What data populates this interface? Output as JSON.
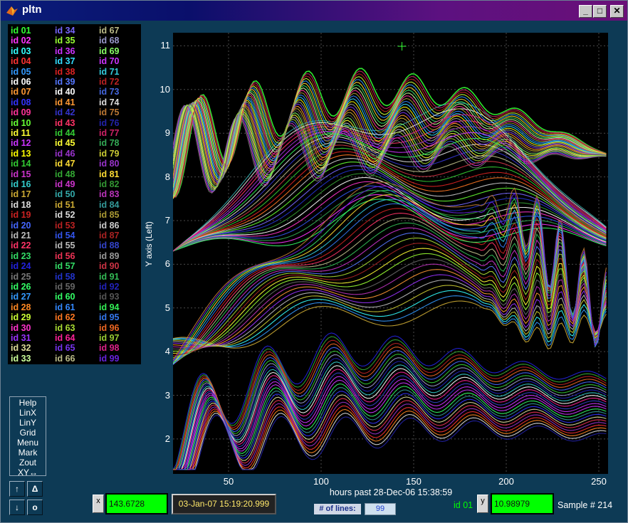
{
  "window": {
    "title": "pltn",
    "icon": "matlab-icon",
    "controls": [
      "_",
      "□",
      "✕"
    ]
  },
  "legend": {
    "items": [
      {
        "label": "id 01",
        "color": "#33ff33"
      },
      {
        "label": "id 02",
        "color": "#ff33ff"
      },
      {
        "label": "id 03",
        "color": "#33ffff"
      },
      {
        "label": "id 04",
        "color": "#ff3333"
      },
      {
        "label": "id 05",
        "color": "#3399ff"
      },
      {
        "label": "id 06",
        "color": "#ffffff"
      },
      {
        "label": "id 07",
        "color": "#ff9933"
      },
      {
        "label": "id 08",
        "color": "#3333ff"
      },
      {
        "label": "id 09",
        "color": "#ff3399"
      },
      {
        "label": "id 10",
        "color": "#66ff33"
      },
      {
        "label": "id 11",
        "color": "#ffff33"
      },
      {
        "label": "id 12",
        "color": "#cc33ff"
      },
      {
        "label": "id 13",
        "color": "#ffff00"
      },
      {
        "label": "id 14",
        "color": "#33cc33"
      },
      {
        "label": "id 15",
        "color": "#cc33cc"
      },
      {
        "label": "id 16",
        "color": "#33cccc"
      },
      {
        "label": "id 17",
        "color": "#ccaa33"
      },
      {
        "label": "id 18",
        "color": "#dddddd"
      },
      {
        "label": "id 19",
        "color": "#cc2222"
      },
      {
        "label": "id 20",
        "color": "#4466ff"
      },
      {
        "label": "id 21",
        "color": "#bbbbbb"
      },
      {
        "label": "id 22",
        "color": "#ff3366"
      },
      {
        "label": "id 23",
        "color": "#33dd66"
      },
      {
        "label": "id 24",
        "color": "#2222dd"
      },
      {
        "label": "id 25",
        "color": "#777777"
      },
      {
        "label": "id 26",
        "color": "#33ff66"
      },
      {
        "label": "id 27",
        "color": "#3399ff"
      },
      {
        "label": "id 28",
        "color": "#ff8822"
      },
      {
        "label": "id 29",
        "color": "#ccff33"
      },
      {
        "label": "id 30",
        "color": "#ff33cc"
      },
      {
        "label": "id 31",
        "color": "#9933ff"
      },
      {
        "label": "id 32",
        "color": "#dddd99"
      },
      {
        "label": "id 33",
        "color": "#ccff99"
      },
      {
        "label": "id 34",
        "color": "#7766ff"
      },
      {
        "label": "id 35",
        "color": "#99ff33"
      },
      {
        "label": "id 36",
        "color": "#cc33ff"
      },
      {
        "label": "id 37",
        "color": "#33ddff"
      },
      {
        "label": "id 38",
        "color": "#dd2222"
      },
      {
        "label": "id 39",
        "color": "#5577ff"
      },
      {
        "label": "id 40",
        "color": "#ffffff"
      },
      {
        "label": "id 41",
        "color": "#ff9933"
      },
      {
        "label": "id 42",
        "color": "#3333cc"
      },
      {
        "label": "id 43",
        "color": "#ff3366"
      },
      {
        "label": "id 44",
        "color": "#33cc33"
      },
      {
        "label": "id 45",
        "color": "#ffff33"
      },
      {
        "label": "id 46",
        "color": "#9933cc"
      },
      {
        "label": "id 47",
        "color": "#ffdd33"
      },
      {
        "label": "id 48",
        "color": "#33aa33"
      },
      {
        "label": "id 49",
        "color": "#cc33cc"
      },
      {
        "label": "id 50",
        "color": "#33aaaa"
      },
      {
        "label": "id 51",
        "color": "#ccaa33"
      },
      {
        "label": "id 52",
        "color": "#dddddd"
      },
      {
        "label": "id 53",
        "color": "#bb2222"
      },
      {
        "label": "id 54",
        "color": "#3355ee"
      },
      {
        "label": "id 55",
        "color": "#bbbbbb"
      },
      {
        "label": "id 56",
        "color": "#ee3355"
      },
      {
        "label": "id 57",
        "color": "#33dd66"
      },
      {
        "label": "id 58",
        "color": "#2233cc"
      },
      {
        "label": "id 59",
        "color": "#666666"
      },
      {
        "label": "id 60",
        "color": "#33ff66"
      },
      {
        "label": "id 61",
        "color": "#3388ff"
      },
      {
        "label": "id 62",
        "color": "#ff7722"
      },
      {
        "label": "id 63",
        "color": "#aadd33"
      },
      {
        "label": "id 64",
        "color": "#ff2299"
      },
      {
        "label": "id 65",
        "color": "#7733ee"
      },
      {
        "label": "id 66",
        "color": "#bbbb88"
      },
      {
        "label": "id 67",
        "color": "#bbbb88"
      },
      {
        "label": "id 68",
        "color": "#9999cc"
      },
      {
        "label": "id 69",
        "color": "#88ff66"
      },
      {
        "label": "id 70",
        "color": "#cc33ff"
      },
      {
        "label": "id 71",
        "color": "#33ccdd"
      },
      {
        "label": "id 72",
        "color": "#bb2222"
      },
      {
        "label": "id 73",
        "color": "#4466dd"
      },
      {
        "label": "id 74",
        "color": "#dddddd"
      },
      {
        "label": "id 75",
        "color": "#bb7733"
      },
      {
        "label": "id 76",
        "color": "#2222aa"
      },
      {
        "label": "id 77",
        "color": "#cc2266"
      },
      {
        "label": "id 78",
        "color": "#33aa55"
      },
      {
        "label": "id 79",
        "color": "#cccc33"
      },
      {
        "label": "id 80",
        "color": "#9933cc"
      },
      {
        "label": "id 81",
        "color": "#ffdd33"
      },
      {
        "label": "id 82",
        "color": "#339933"
      },
      {
        "label": "id 83",
        "color": "#bb33bb"
      },
      {
        "label": "id 84",
        "color": "#339999"
      },
      {
        "label": "id 85",
        "color": "#aa9933"
      },
      {
        "label": "id 86",
        "color": "#cccccc"
      },
      {
        "label": "id 87",
        "color": "#aa2222"
      },
      {
        "label": "id 88",
        "color": "#3344cc"
      },
      {
        "label": "id 89",
        "color": "#999999"
      },
      {
        "label": "id 90",
        "color": "#cc3344"
      },
      {
        "label": "id 91",
        "color": "#33bb55"
      },
      {
        "label": "id 92",
        "color": "#2222bb"
      },
      {
        "label": "id 93",
        "color": "#555555"
      },
      {
        "label": "id 94",
        "color": "#33ee55"
      },
      {
        "label": "id 95",
        "color": "#3377ee"
      },
      {
        "label": "id 96",
        "color": "#ee6622"
      },
      {
        "label": "id 97",
        "color": "#99cc33"
      },
      {
        "label": "id 98",
        "color": "#dd2288"
      },
      {
        "label": "id 99",
        "color": "#6622dd"
      }
    ]
  },
  "menu": {
    "items": [
      "Help",
      "LinX",
      "LinY",
      "Grid",
      "Menu",
      "Mark",
      "Zout",
      "XY↔"
    ]
  },
  "nav_buttons": {
    "up": "↑",
    "delta": "Δ",
    "down": "↓",
    "origin": "o"
  },
  "chart_data": {
    "type": "line",
    "ylabel": "Y axis (Left)",
    "xlabel": "hours past 28-Dec-06 15:38:59",
    "xlim": [
      20,
      255
    ],
    "ylim": [
      1.2,
      11.3
    ],
    "x_ticks": [
      50,
      100,
      150,
      200,
      250
    ],
    "y_ticks": [
      2,
      3,
      4,
      5,
      6,
      7,
      8,
      9,
      10,
      11
    ],
    "grid": true,
    "series_count": 99,
    "cursor": {
      "x": 143.6728,
      "y": 10.98979
    }
  },
  "readout": {
    "x_label": "x",
    "x_value": "143.6728",
    "timestamp": "03-Jan-07 15:19:20.999",
    "num_lines_label": "# of lines:",
    "num_lines": "99",
    "current_id": "id 01",
    "y_label": "y",
    "y_value": "10.98979",
    "sample": "Sample  # 214"
  }
}
